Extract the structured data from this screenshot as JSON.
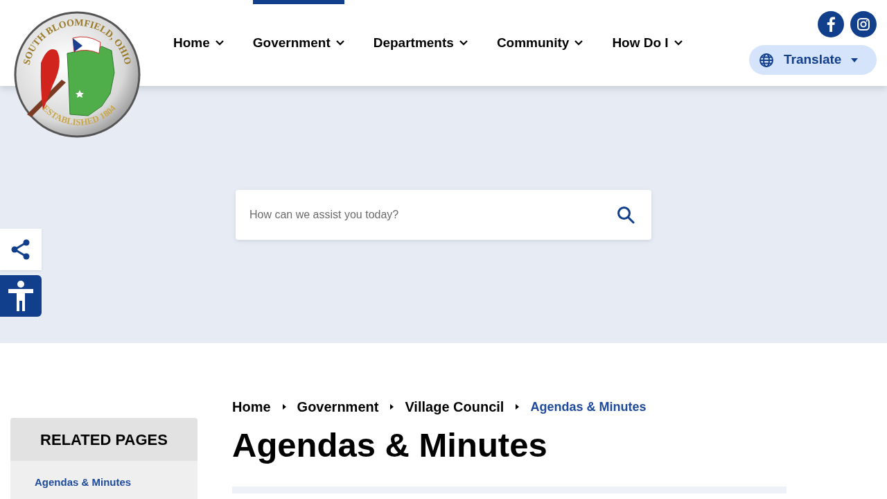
{
  "logo": {
    "top_text": "SOUTH BLOOMFIELD, OHIO",
    "bottom_text": "ESTABLISHED 1804"
  },
  "nav": [
    {
      "label": "Home",
      "selected": false
    },
    {
      "label": "Government",
      "selected": true
    },
    {
      "label": "Departments",
      "selected": false
    },
    {
      "label": "Community",
      "selected": false
    },
    {
      "label": "How Do I",
      "selected": false
    }
  ],
  "translate": {
    "label": "Translate"
  },
  "search": {
    "placeholder": "How can we assist you today?"
  },
  "breadcrumb": [
    {
      "label": "Home",
      "current": false
    },
    {
      "label": "Government",
      "current": false
    },
    {
      "label": "Village Council",
      "current": false
    },
    {
      "label": "Agendas & Minutes",
      "current": true
    }
  ],
  "page_title": "Agendas & Minutes",
  "related_pages": {
    "title": "RELATED PAGES",
    "items": [
      {
        "label": "Agendas & Minutes"
      }
    ]
  }
}
